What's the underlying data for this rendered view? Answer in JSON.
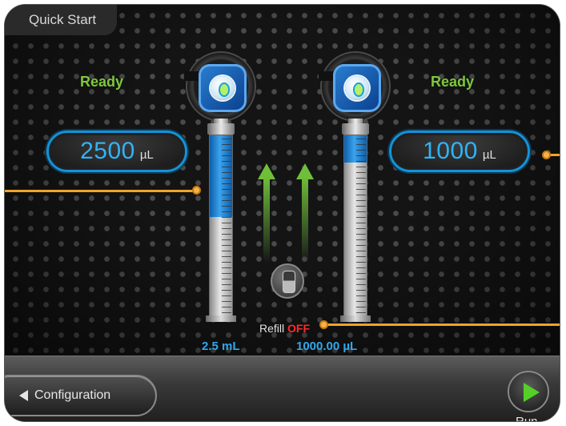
{
  "header": {
    "title": "Quick Start"
  },
  "left_pump": {
    "status": "Ready",
    "volume": "2500",
    "unit": "µL",
    "syringe_label": "2.5 mL",
    "fill_fraction": 0.45
  },
  "right_pump": {
    "status": "Ready",
    "volume": "1000",
    "unit": "µL",
    "syringe_label": "1000.00 µL",
    "fill_fraction": 0.15
  },
  "refill": {
    "label": "Refill",
    "state": "OFF"
  },
  "footer": {
    "config_label": "Configuration",
    "run_label": "Run"
  },
  "colors": {
    "status": "#7ec83b",
    "value": "#2fb4f5",
    "refill_off": "#ff2a2a",
    "pointer": "#f1a32a"
  }
}
